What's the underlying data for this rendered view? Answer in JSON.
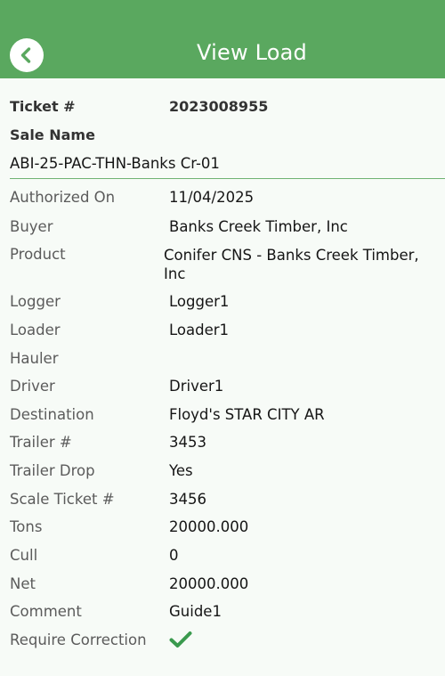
{
  "header": {
    "title": "View Load",
    "back_icon": "chevron-left-icon",
    "color": "#5aa85f"
  },
  "ticket": {
    "label": "Ticket #",
    "value": "2023008955"
  },
  "sale": {
    "label": "Sale Name",
    "value": "ABI-25-PAC-THN-Banks Cr-01"
  },
  "fields": [
    {
      "label": "Authorized On",
      "value": "11/04/2025"
    },
    {
      "label": "Buyer",
      "value": "Banks Creek Timber, Inc"
    },
    {
      "label": "Product",
      "value": "Conifer CNS - Banks Creek Timber, Inc"
    },
    {
      "label": "Logger",
      "value": "Logger1"
    },
    {
      "label": "Loader",
      "value": "Loader1"
    },
    {
      "label": "Hauler",
      "value": ""
    },
    {
      "label": "Driver",
      "value": "Driver1"
    },
    {
      "label": "Destination",
      "value": "Floyd's STAR CITY AR"
    },
    {
      "label": "Trailer #",
      "value": "3453"
    },
    {
      "label": "Trailer Drop",
      "value": "Yes"
    },
    {
      "label": "Scale Ticket #",
      "value": "3456"
    },
    {
      "label": "Tons",
      "value": "20000.000"
    },
    {
      "label": "Cull",
      "value": "0"
    },
    {
      "label": "Net",
      "value": "20000.000"
    },
    {
      "label": "Comment",
      "value": "Guide1"
    },
    {
      "label": "Require Correction",
      "value": "checked",
      "icon": "checkmark-icon",
      "color": "#3a9a4e"
    }
  ]
}
